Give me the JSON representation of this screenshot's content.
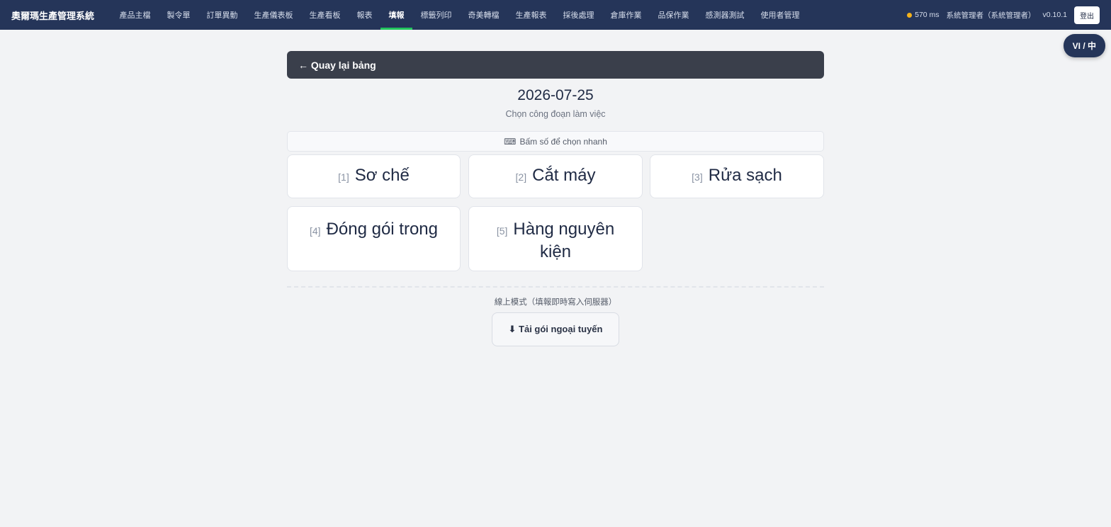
{
  "header": {
    "app_title": "奧爾瑪生產管理系統",
    "nav": [
      {
        "label": "產品主檔",
        "active": false
      },
      {
        "label": "製令單",
        "active": false
      },
      {
        "label": "訂單異動",
        "active": false
      },
      {
        "label": "生產儀表板",
        "active": false
      },
      {
        "label": "生產看板",
        "active": false
      },
      {
        "label": "報表",
        "active": false
      },
      {
        "label": "填報",
        "active": true
      },
      {
        "label": "標籤列印",
        "active": false
      },
      {
        "label": "奇美轉檔",
        "active": false
      },
      {
        "label": "生產報表",
        "active": false
      },
      {
        "label": "採後處理",
        "active": false
      },
      {
        "label": "倉庫作業",
        "active": false
      },
      {
        "label": "品保作業",
        "active": false
      },
      {
        "label": "感測器測試",
        "active": false
      },
      {
        "label": "使用者管理",
        "active": false
      }
    ],
    "latency": "570 ms",
    "latency_color": "#f5b21b",
    "user": "系統管理者（系統管理者）",
    "version": "v0.10.1",
    "logout_label": "登出"
  },
  "lang_toggle": "VI / 中",
  "back_label": "← Quay lại bảng",
  "date": "2026-07-25",
  "subtitle": "Chọn công đoạn làm việc",
  "hint": {
    "icon": "keyboard-icon",
    "glyph": "⌨",
    "text": "Bấm số để chọn nhanh"
  },
  "stations": [
    {
      "key": "[1]",
      "name": "Sơ chế"
    },
    {
      "key": "[2]",
      "name": "Cắt máy"
    },
    {
      "key": "[3]",
      "name": "Rửa sạch"
    },
    {
      "key": "[4]",
      "name": "Đóng gói trong"
    },
    {
      "key": "[5]",
      "name": "Hàng nguyên kiện"
    }
  ],
  "mode_text": "線上模式（填報即時寫入伺服器）",
  "download_label": "⬇ Tải gói ngoại tuyến",
  "colors": {
    "topbar": "#253559",
    "accent_active": "#22c55e",
    "back_bar": "#3a3f4b",
    "background": "#f2f3f5"
  }
}
